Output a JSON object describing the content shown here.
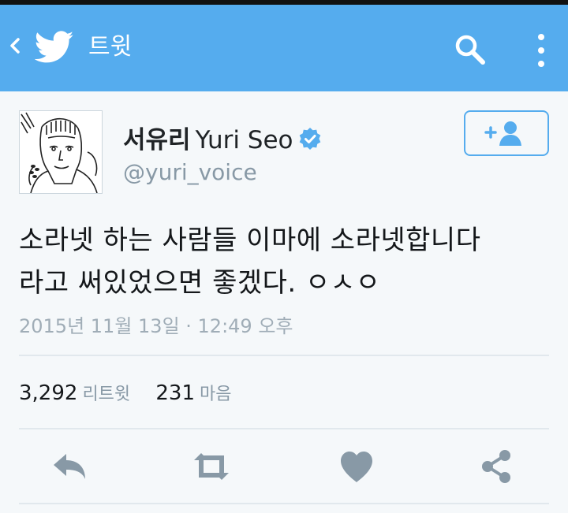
{
  "header": {
    "title": "트윗"
  },
  "tweet": {
    "display_name": "서유리",
    "latin_name": "Yuri Seo",
    "handle": "@yuri_voice",
    "text_lines": [
      "소라넷 하는 사람들 이마에 소라넷합니다",
      "라고 써있었으면 좋겠다. ㅇㅅㅇ"
    ],
    "timestamp": "2015년 11월 13일 · 12:49 오후"
  },
  "stats": {
    "retweets_count": "3,292",
    "retweets_label": "리트윗",
    "likes_count": "231",
    "likes_label": "마음"
  },
  "icons": {
    "back": "back-arrow-icon",
    "logo": "twitter-bird-icon",
    "search": "search-icon",
    "more": "more-vertical-icon",
    "verified": "verified-badge-icon",
    "follow": "add-user-icon",
    "reply": "reply-icon",
    "retweet": "retweet-icon",
    "like": "heart-icon",
    "share": "share-icon"
  },
  "colors": {
    "header_bg": "#55acee",
    "page_bg": "#f5f8fa",
    "action_icon": "#8899a6",
    "verified": "#55acee"
  }
}
